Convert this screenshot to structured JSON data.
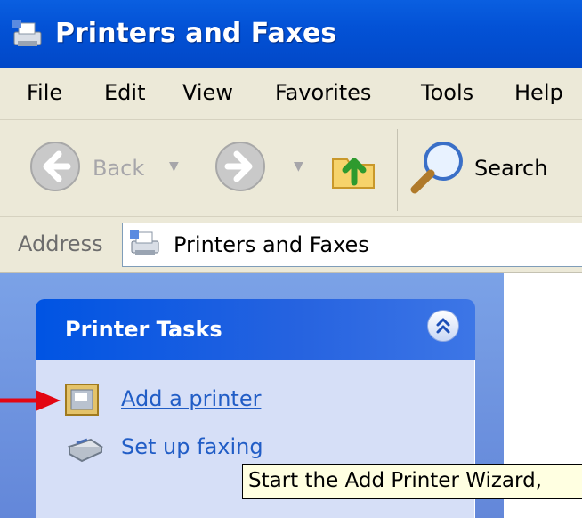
{
  "window": {
    "title": "Printers and Faxes"
  },
  "menu": {
    "items": [
      "File",
      "Edit",
      "View",
      "Favorites",
      "Tools",
      "Help"
    ]
  },
  "toolbar": {
    "back_label": "Back",
    "search_label": "Search"
  },
  "address": {
    "label": "Address",
    "value": "Printers and Faxes"
  },
  "tasks": {
    "title": "Printer Tasks",
    "items": [
      {
        "label": "Add a printer",
        "icon": "add-printer-icon",
        "hovered": true
      },
      {
        "label": "Set up faxing",
        "icon": "fax-icon",
        "hovered": false
      }
    ]
  },
  "tooltip": {
    "text": "Start the Add Printer Wizard,"
  },
  "colors": {
    "titlebar": "#0352d6",
    "link": "#215dc6",
    "annotation_arrow": "#e30613",
    "tooltip_bg": "#ffffe1"
  }
}
